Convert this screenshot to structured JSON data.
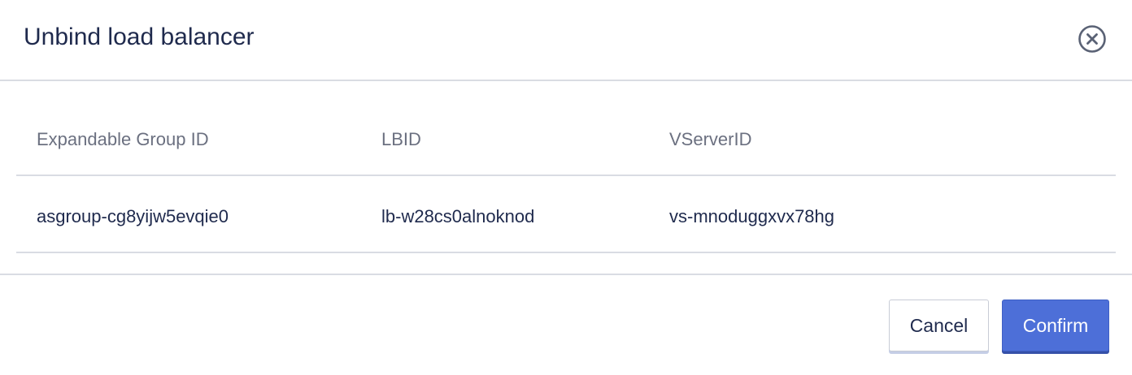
{
  "dialog": {
    "title": "Unbind load balancer"
  },
  "table": {
    "columns": [
      "Expandable Group ID",
      "LBID",
      "VServerID"
    ],
    "rows": [
      [
        "asgroup-cg8yijw5evqie0",
        "lb-w28cs0alnoknod",
        "vs-mnoduggxvx78hg"
      ]
    ]
  },
  "footer": {
    "cancel_label": "Cancel",
    "confirm_label": "Confirm"
  },
  "icons": {
    "close": "close-circle-icon"
  },
  "colors": {
    "primary": "#4d6fd8",
    "text": "#1f2a4d",
    "muted_text": "#6b7080",
    "divider": "#d9dce3"
  }
}
